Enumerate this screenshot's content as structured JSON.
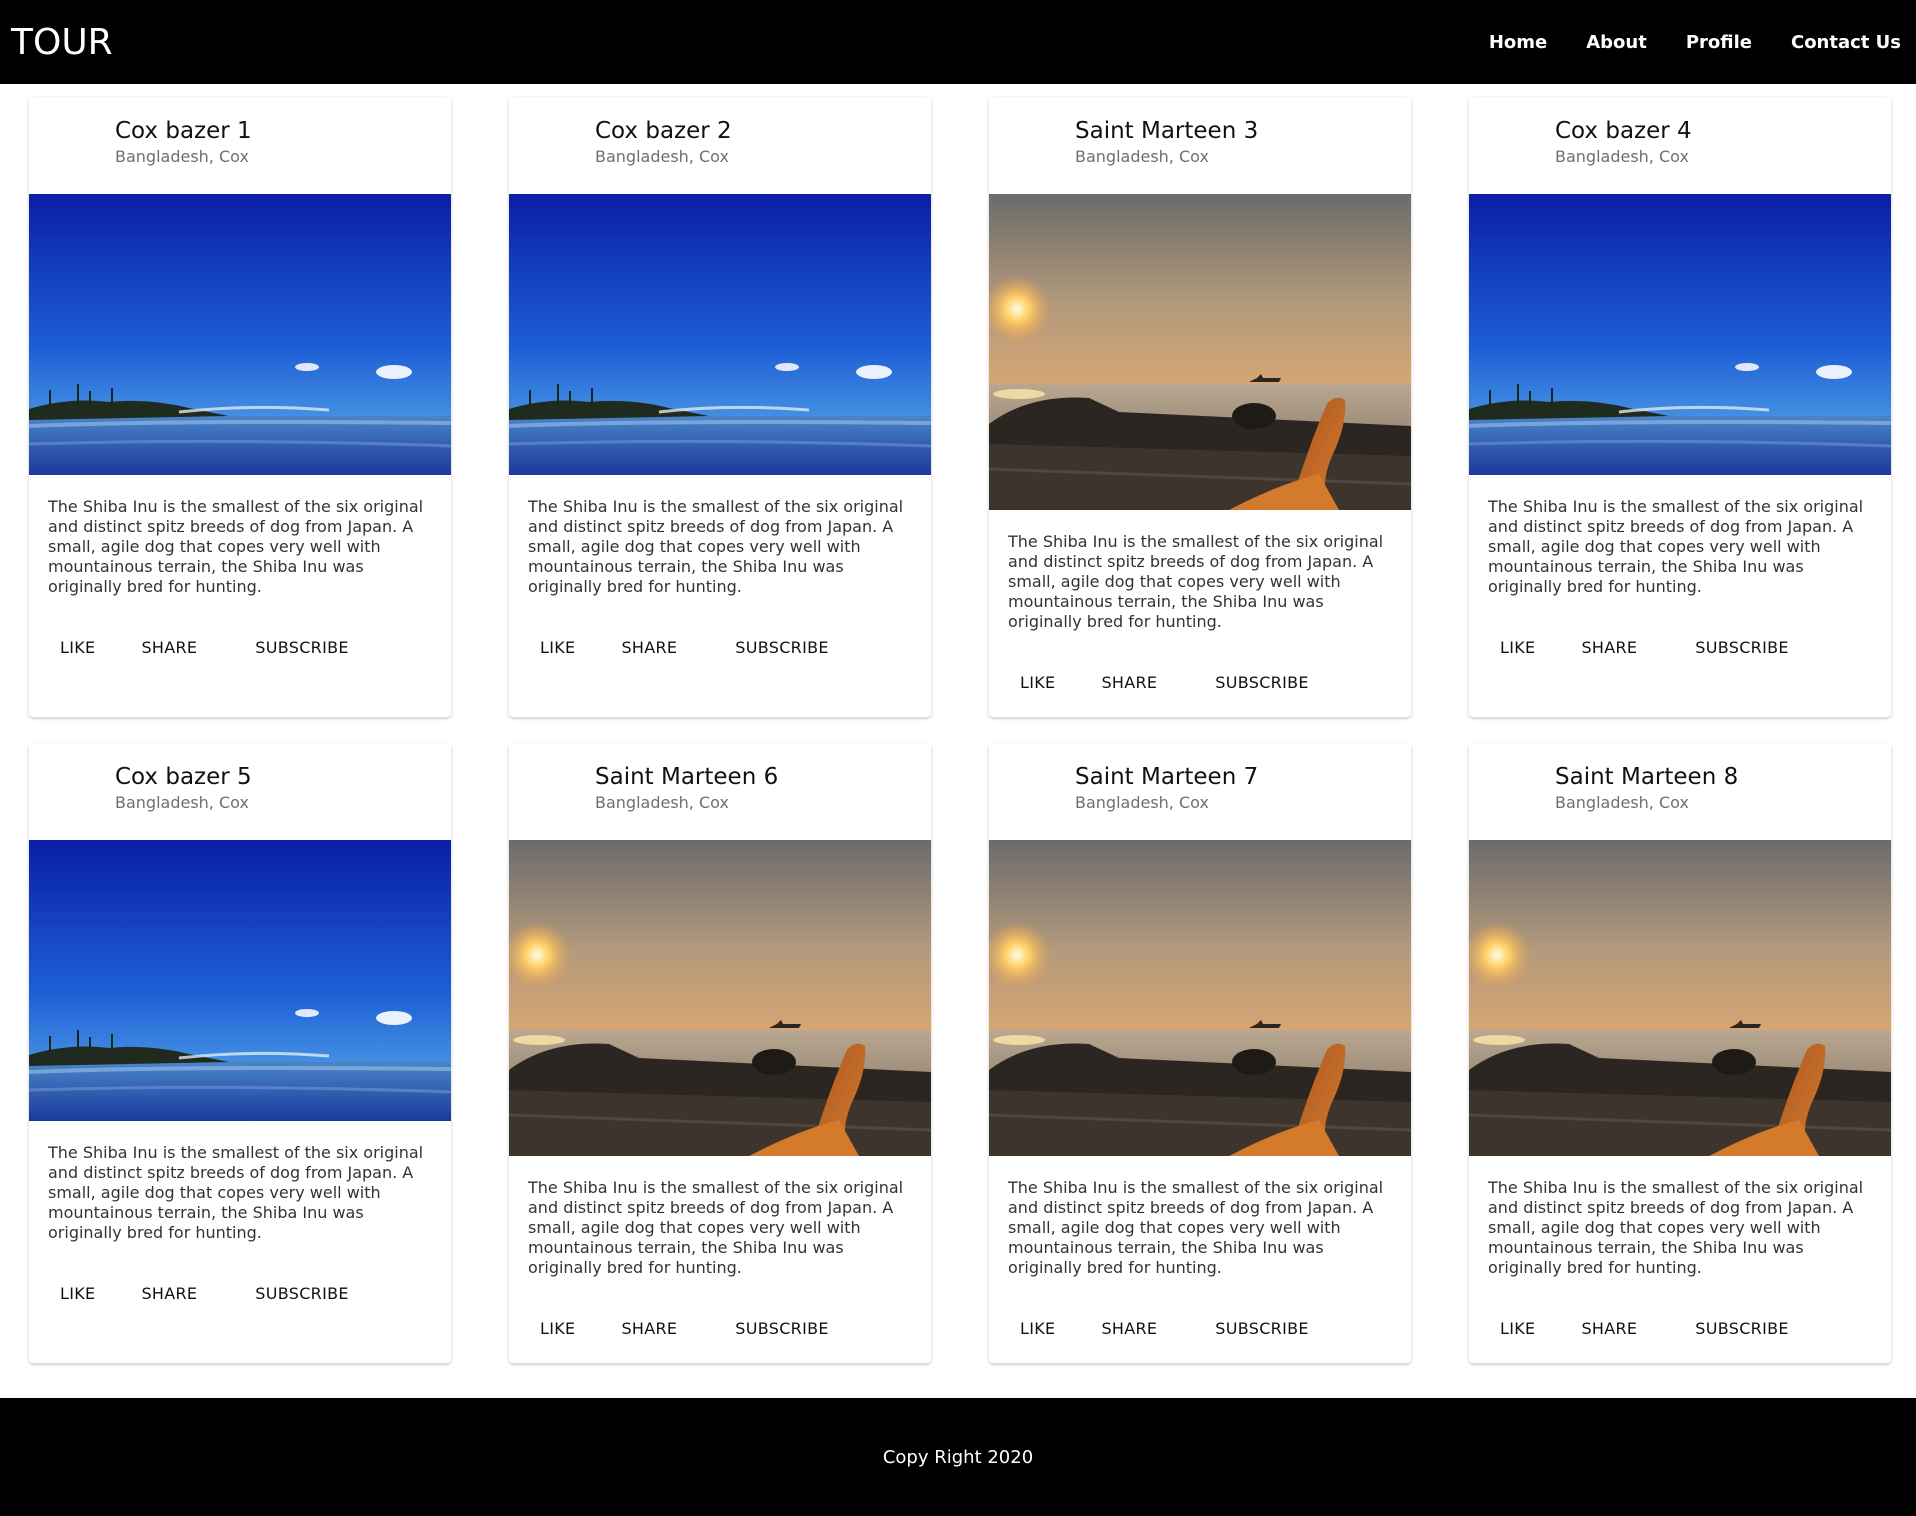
{
  "brand": "TOUR",
  "nav": {
    "items": [
      {
        "label": "Home"
      },
      {
        "label": "About"
      },
      {
        "label": "Profile"
      },
      {
        "label": "Contact Us"
      }
    ]
  },
  "cards": [
    {
      "title": "Cox bazer 1",
      "subtitle": "Bangladesh, Cox",
      "image": "beach",
      "text": "The Shiba Inu is the smallest of the six original and distinct spitz breeds of dog from Japan. A small, agile dog that copes very well with mountainous terrain, the Shiba Inu was originally bred for hunting.",
      "actions": {
        "like": "LIKE",
        "share": "SHARE",
        "subscribe": "SUBSCRIBE"
      }
    },
    {
      "title": "Cox bazer 2",
      "subtitle": "Bangladesh, Cox",
      "image": "beach",
      "text": "The Shiba Inu is the smallest of the six original and distinct spitz breeds of dog from Japan. A small, agile dog that copes very well with mountainous terrain, the Shiba Inu was originally bred for hunting.",
      "actions": {
        "like": "LIKE",
        "share": "SHARE",
        "subscribe": "SUBSCRIBE"
      }
    },
    {
      "title": "Saint Marteen 3",
      "subtitle": "Bangladesh, Cox",
      "image": "sunset",
      "text": "The Shiba Inu is the smallest of the six original and distinct spitz breeds of dog from Japan. A small, agile dog that copes very well with mountainous terrain, the Shiba Inu was originally bred for hunting.",
      "actions": {
        "like": "LIKE",
        "share": "SHARE",
        "subscribe": "SUBSCRIBE"
      }
    },
    {
      "title": "Cox bazer 4",
      "subtitle": "Bangladesh, Cox",
      "image": "beach",
      "text": "The Shiba Inu is the smallest of the six original and distinct spitz breeds of dog from Japan. A small, agile dog that copes very well with mountainous terrain, the Shiba Inu was originally bred for hunting.",
      "actions": {
        "like": "LIKE",
        "share": "SHARE",
        "subscribe": "SUBSCRIBE"
      }
    },
    {
      "title": "Cox bazer 5",
      "subtitle": "Bangladesh, Cox",
      "image": "beach",
      "text": "The Shiba Inu is the smallest of the six original and distinct spitz breeds of dog from Japan. A small, agile dog that copes very well with mountainous terrain, the Shiba Inu was originally bred for hunting.",
      "actions": {
        "like": "LIKE",
        "share": "SHARE",
        "subscribe": "SUBSCRIBE"
      }
    },
    {
      "title": "Saint Marteen 6",
      "subtitle": "Bangladesh, Cox",
      "image": "sunset",
      "text": "The Shiba Inu is the smallest of the six original and distinct spitz breeds of dog from Japan. A small, agile dog that copes very well with mountainous terrain, the Shiba Inu was originally bred for hunting.",
      "actions": {
        "like": "LIKE",
        "share": "SHARE",
        "subscribe": "SUBSCRIBE"
      }
    },
    {
      "title": "Saint Marteen 7",
      "subtitle": "Bangladesh, Cox",
      "image": "sunset",
      "text": "The Shiba Inu is the smallest of the six original and distinct spitz breeds of dog from Japan. A small, agile dog that copes very well with mountainous terrain, the Shiba Inu was originally bred for hunting.",
      "actions": {
        "like": "LIKE",
        "share": "SHARE",
        "subscribe": "SUBSCRIBE"
      }
    },
    {
      "title": "Saint Marteen 8",
      "subtitle": "Bangladesh, Cox",
      "image": "sunset",
      "text": "The Shiba Inu is the smallest of the six original and distinct spitz breeds of dog from Japan. A small, agile dog that copes very well with mountainous terrain, the Shiba Inu was originally bred for hunting.",
      "actions": {
        "like": "LIKE",
        "share": "SHARE",
        "subscribe": "SUBSCRIBE"
      }
    }
  ],
  "footer": {
    "text": "Copy Right 2020"
  },
  "colors": {
    "navbar": "#000000",
    "footer": "#000000",
    "background": "#ffffff"
  }
}
